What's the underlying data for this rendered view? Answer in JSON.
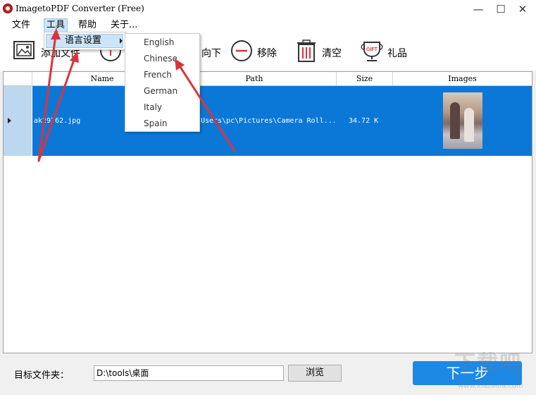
{
  "window": {
    "title": "ImagetoPDF Converter (Free)",
    "minimize_glyph": "—",
    "maximize_glyph": "☐",
    "close_glyph": "✕"
  },
  "menubar": {
    "items": [
      "文件",
      "工具",
      "帮助",
      "关于..."
    ]
  },
  "toolbar": {
    "add_label": "添加文件",
    "down_label": "向下",
    "remove_label": "移除",
    "clear_label": "清空",
    "gift_label": "礼品",
    "gift_icon_text": "GIFT"
  },
  "grid": {
    "columns": [
      "Name",
      "Path",
      "Size",
      "Images"
    ],
    "rows": [
      {
        "name": "ak29762.jpg",
        "path": "Users\\pc\\Pictures\\Camera Roll...",
        "size": "34.72 K"
      }
    ]
  },
  "tools_menu": {
    "language_item": "语言设置"
  },
  "language_menu": {
    "items": [
      "English",
      "Chinese",
      "French",
      "German",
      "Italy",
      "Spain"
    ]
  },
  "bottom": {
    "target_label": "目标文件夹：",
    "target_path": "D:\\tools\\桌面",
    "browse_label": "浏览",
    "next_label": "下一步"
  },
  "watermark": {
    "text": "下载吧",
    "sub": "www.xiazaiba.com"
  },
  "colors": {
    "selection": "#0b78d7",
    "next_button": "#1e88e5",
    "arrow": "#d9343d"
  }
}
